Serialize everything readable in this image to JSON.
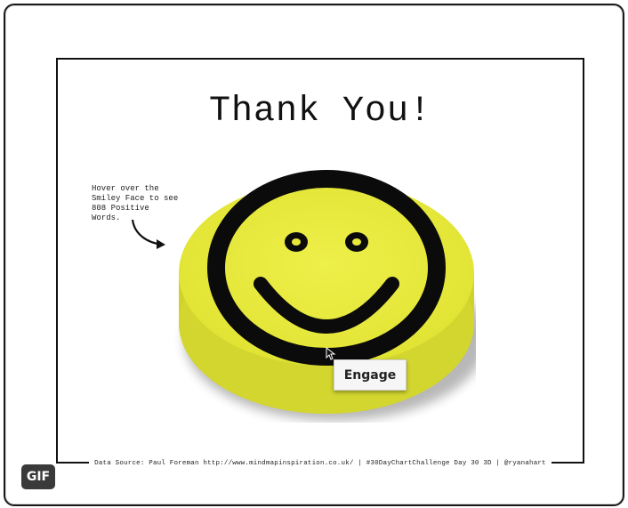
{
  "title": "Thank You!",
  "hint": {
    "line1": "Hover over the",
    "line2": "Smiley Face to see",
    "line3": "808 Positive",
    "line4": "Words."
  },
  "engage_button": {
    "label": "Engage"
  },
  "footer": {
    "text": "Data Source: Paul Foreman http://www.mindmapinspiration.co.uk/ | #30DayChartChallenge Day 30 3D | @ryanahart"
  },
  "gif_badge": {
    "label": "GIF"
  },
  "icons": {
    "smiley": "smiley-face-icon",
    "arrow": "curved-arrow-icon",
    "cursor": "mouse-pointer-icon"
  },
  "colors": {
    "smiley_top": "#e6e83a",
    "smiley_side": "#cfd22a",
    "outline": "#0b0b0b",
    "badge_bg": "#3a3a3a"
  }
}
